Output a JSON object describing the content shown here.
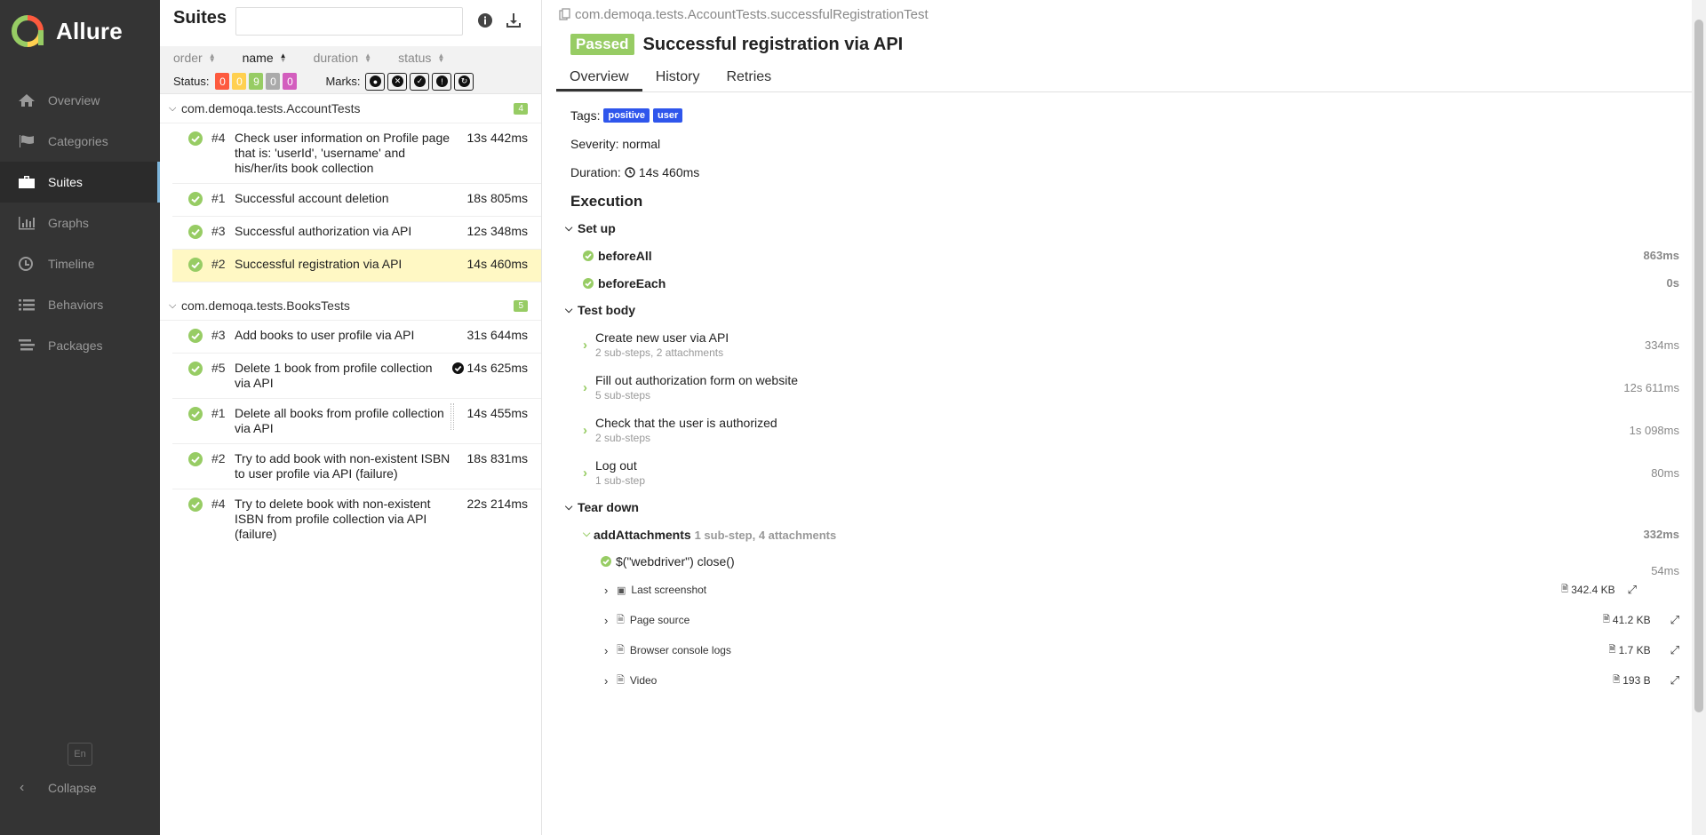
{
  "brand": {
    "name": "Allure"
  },
  "nav": [
    {
      "label": "Overview",
      "icon": "home-icon"
    },
    {
      "label": "Categories",
      "icon": "flag-icon"
    },
    {
      "label": "Suites",
      "icon": "briefcase-icon"
    },
    {
      "label": "Graphs",
      "icon": "bar-chart-icon"
    },
    {
      "label": "Timeline",
      "icon": "clock-icon"
    },
    {
      "label": "Behaviors",
      "icon": "list-icon"
    },
    {
      "label": "Packages",
      "icon": "packages-icon"
    }
  ],
  "sidebar_footer": {
    "lang": "En",
    "collapse": "Collapse"
  },
  "suites": {
    "title": "Suites",
    "search_placeholder": "",
    "sort": {
      "order": "order",
      "name": "name",
      "duration": "duration",
      "status": "status"
    },
    "status_label": "Status:",
    "status_counts": [
      {
        "value": "0",
        "color": "#fd5a3e"
      },
      {
        "value": "0",
        "color": "#ffd050"
      },
      {
        "value": "9",
        "color": "#97cc64"
      },
      {
        "value": "0",
        "color": "#aaaaaa"
      },
      {
        "value": "0",
        "color": "#d35ebe"
      }
    ],
    "marks_label": "Marks:",
    "groups": [
      {
        "name": "com.demoqa.tests.AccountTests",
        "count": "4",
        "items": [
          {
            "num": "#4",
            "name": "Check user information on Profile page that is: 'userId', 'username' and his/her/its book collection",
            "time": "13s 442ms"
          },
          {
            "num": "#1",
            "name": "Successful account deletion",
            "time": "18s 805ms"
          },
          {
            "num": "#3",
            "name": "Successful authorization via API",
            "time": "12s 348ms"
          },
          {
            "num": "#2",
            "name": "Successful registration via API",
            "time": "14s 460ms"
          }
        ]
      },
      {
        "name": "com.demoqa.tests.BooksTests",
        "count": "5",
        "items": [
          {
            "num": "#3",
            "name": "Add books to user profile via API",
            "time": "31s 644ms"
          },
          {
            "num": "#5",
            "name": "Delete 1 book from profile collection via API",
            "time": "14s 625ms"
          },
          {
            "num": "#1",
            "name": "Delete all books from profile collection via API",
            "time": "14s 455ms"
          },
          {
            "num": "#2",
            "name": "Try to add book with non-existent ISBN to user profile via API (failure)",
            "time": "18s 831ms"
          },
          {
            "num": "#4",
            "name": "Try to delete book with non-existent ISBN from profile collection via API (failure)",
            "time": "22s 214ms"
          }
        ]
      }
    ]
  },
  "details": {
    "breadcrumb": "com.demoqa.tests.AccountTests.successfulRegistrationTest",
    "status": "Passed",
    "title": "Successful registration via API",
    "tabs": [
      "Overview",
      "History",
      "Retries"
    ],
    "tags_label": "Tags:",
    "tags": [
      "positive",
      "user"
    ],
    "severity": "Severity: normal",
    "duration_label": "Duration:",
    "duration": "14s 460ms",
    "execution": "Execution",
    "setup": {
      "label": "Set up",
      "steps": [
        {
          "name": "beforeAll",
          "dur": "863ms"
        },
        {
          "name": "beforeEach",
          "dur": "0s"
        }
      ]
    },
    "body": {
      "label": "Test body",
      "steps": [
        {
          "name": "Create new user via API",
          "sub": "2 sub-steps, 2 attachments",
          "dur": "334ms"
        },
        {
          "name": "Fill out authorization form on website",
          "sub": "5 sub-steps",
          "dur": "12s 611ms"
        },
        {
          "name": "Check that the user is authorized",
          "sub": "2 sub-steps",
          "dur": "1s 098ms"
        },
        {
          "name": "Log out",
          "sub": "1 sub-step",
          "dur": "80ms"
        }
      ]
    },
    "teardown": {
      "label": "Tear down",
      "fixture": {
        "name": "addAttachments",
        "sub": "1 sub-step, 4 attachments",
        "dur": "332ms"
      },
      "substep": {
        "name": "$(\"webdriver\") close()",
        "dur": "54ms"
      },
      "attachments": [
        {
          "name": "Last screenshot",
          "size": "342.4 KB"
        },
        {
          "name": "Page source",
          "size": "41.2 KB"
        },
        {
          "name": "Browser console logs",
          "size": "1.7 KB"
        },
        {
          "name": "Video",
          "size": "193 B"
        }
      ]
    }
  }
}
